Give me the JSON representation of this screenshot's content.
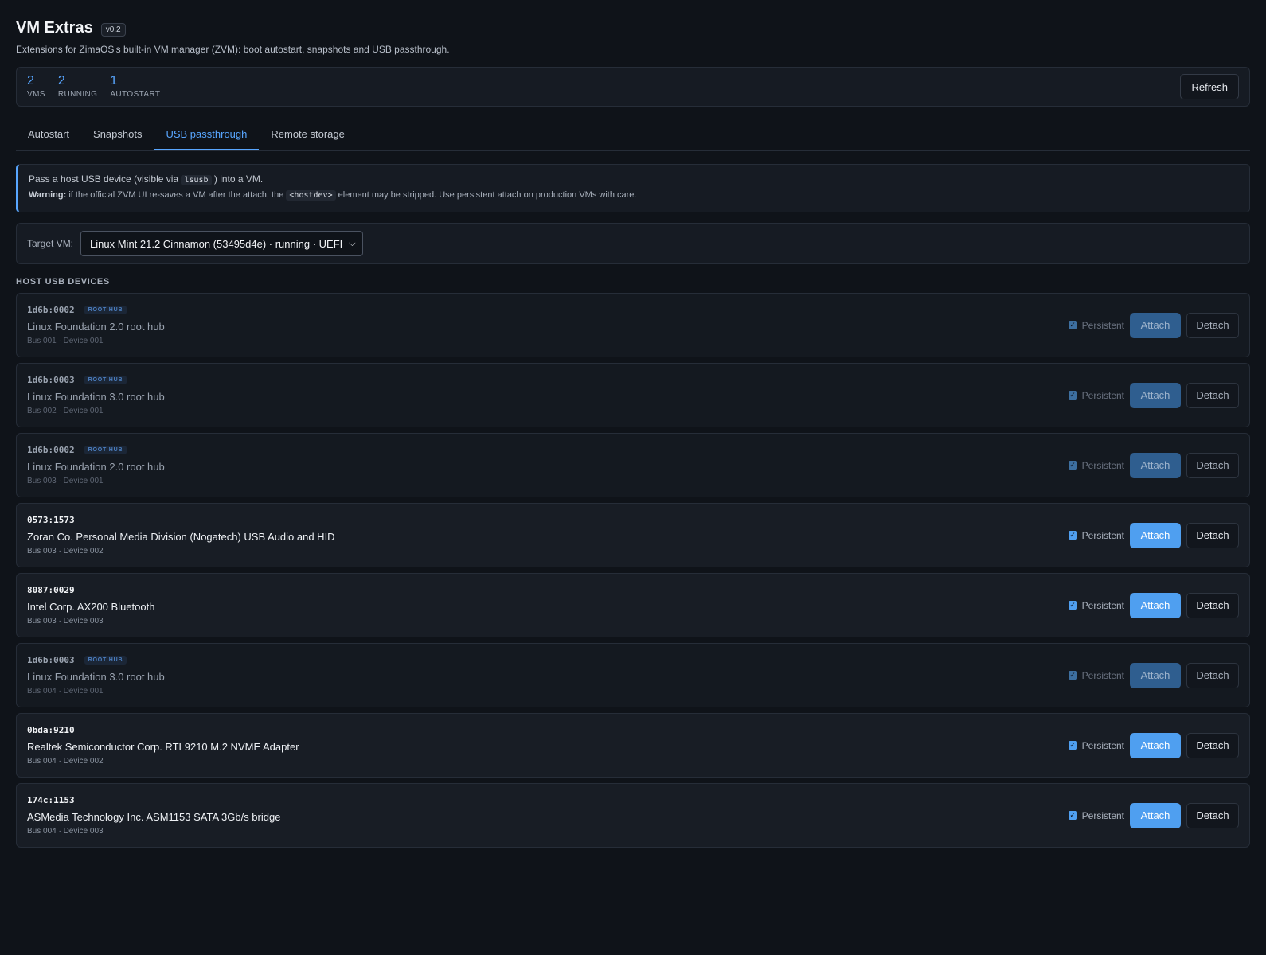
{
  "header": {
    "title": "VM Extras",
    "version": "v0.2",
    "subtitle": "Extensions for ZimaOS's built-in VM manager (ZVM): boot autostart, snapshots and USB passthrough."
  },
  "stats": {
    "vms_value": "2",
    "vms_label": "VMS",
    "running_value": "2",
    "running_label": "RUNNING",
    "autostart_value": "1",
    "autostart_label": "AUTOSTART",
    "refresh_label": "Refresh"
  },
  "tabs": [
    {
      "label": "Autostart"
    },
    {
      "label": "Snapshots"
    },
    {
      "label": "USB passthrough",
      "active": true
    },
    {
      "label": "Remote storage"
    }
  ],
  "info": {
    "line1_pre": "Pass a host USB device (visible via",
    "line1_code": "lsusb",
    "line1_post": ") into a VM.",
    "warning_label": "Warning:",
    "line2_pre": "if the official ZVM UI re-saves a VM after the attach, the",
    "line2_code": "<hostdev>",
    "line2_post": "element may be stripped. Use persistent attach on production VMs with care."
  },
  "target": {
    "label": "Target VM:",
    "selected": "Linux Mint 21.2 Cinnamon (53495d4e) · running · UEFI"
  },
  "section_title": "HOST USB DEVICES",
  "device_controls": {
    "persistent_label": "Persistent",
    "attach_label": "Attach",
    "detach_label": "Detach",
    "root_hub_badge": "ROOT HUB"
  },
  "devices": [
    {
      "id": "1d6b:0002",
      "root_hub": true,
      "name": "Linux Foundation 2.0 root hub",
      "bus": "Bus 001 · Device 001",
      "persistent": true
    },
    {
      "id": "1d6b:0003",
      "root_hub": true,
      "name": "Linux Foundation 3.0 root hub",
      "bus": "Bus 002 · Device 001",
      "persistent": true
    },
    {
      "id": "1d6b:0002",
      "root_hub": true,
      "name": "Linux Foundation 2.0 root hub",
      "bus": "Bus 003 · Device 001",
      "persistent": true
    },
    {
      "id": "0573:1573",
      "root_hub": false,
      "name": "Zoran Co. Personal Media Division (Nogatech) USB Audio and HID",
      "bus": "Bus 003 · Device 002",
      "persistent": true
    },
    {
      "id": "8087:0029",
      "root_hub": false,
      "name": "Intel Corp. AX200 Bluetooth",
      "bus": "Bus 003 · Device 003",
      "persistent": true
    },
    {
      "id": "1d6b:0003",
      "root_hub": true,
      "name": "Linux Foundation 3.0 root hub",
      "bus": "Bus 004 · Device 001",
      "persistent": true
    },
    {
      "id": "0bda:9210",
      "root_hub": false,
      "name": "Realtek Semiconductor Corp. RTL9210 M.2 NVME Adapter",
      "bus": "Bus 004 · Device 002",
      "persistent": true
    },
    {
      "id": "174c:1153",
      "root_hub": false,
      "name": "ASMedia Technology Inc. ASM1153 SATA 3Gb/s bridge",
      "bus": "Bus 004 · Device 003",
      "persistent": true
    }
  ]
}
